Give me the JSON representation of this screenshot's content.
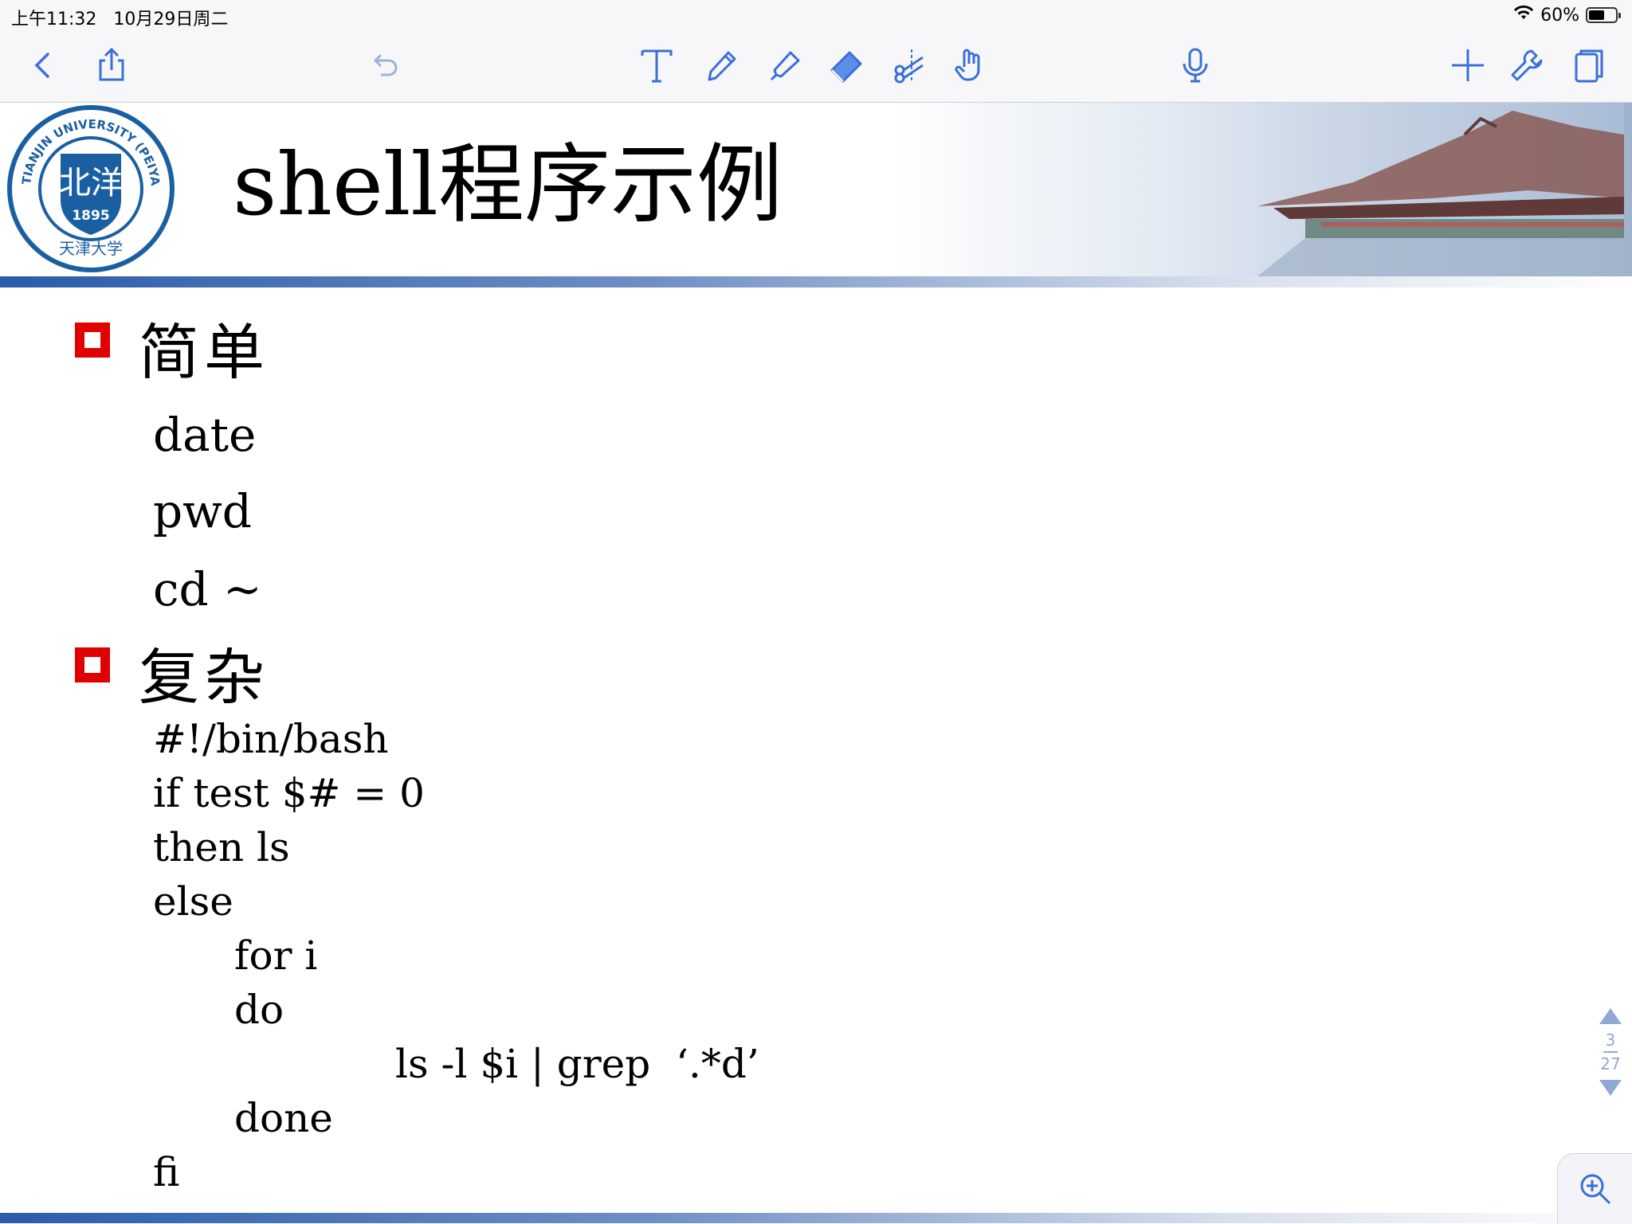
{
  "status_bar": {
    "time": "上午11:32",
    "date": "10月29日周二",
    "battery": "60%",
    "battery_level": 0.6
  },
  "toolbar": {
    "left": [
      "back-icon",
      "share-icon",
      "undo-icon"
    ],
    "center": [
      "text-tool-icon",
      "pen-tool-icon",
      "highlighter-tool-icon",
      "eraser-tool-icon",
      "lasso-scissors-icon",
      "hand-pointer-icon"
    ],
    "mic": "microphone-icon",
    "right": [
      "add-icon",
      "wrench-icon",
      "pages-icon"
    ],
    "accent": "#3a6fd8"
  },
  "slide": {
    "logo_text": "TIANJIN UNIVERSITY (PEIYANG UNIVERSITY)",
    "logo_year": "1895",
    "logo_glyph": "北洋",
    "logo_script": "天津大学",
    "title": "shell程序示例",
    "section1": {
      "heading": "简单",
      "lines": [
        "date",
        "pwd",
        "cd ~"
      ]
    },
    "section2": {
      "heading": "复杂",
      "lines": [
        "#!/bin/bash",
        "if test $# = 0",
        "then ls",
        "else",
        "for i",
        "do",
        "ls -l $i | grep  ‘.*d’",
        "done",
        "fi"
      ]
    }
  },
  "pager": {
    "current": "3",
    "total": "27"
  }
}
